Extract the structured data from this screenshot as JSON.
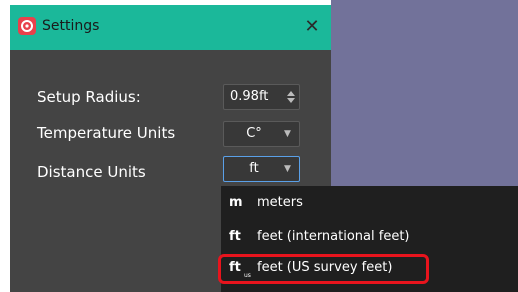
{
  "window": {
    "title": "Settings",
    "close_glyph": "✕",
    "app_icon": "app-logo-icon",
    "titlebar_color": "#1bb89a",
    "background_color": "#444444"
  },
  "viewport": {
    "color": "#72729a"
  },
  "settings": {
    "setup_radius": {
      "label": "Setup Radius:",
      "value": "0.98ft"
    },
    "temperature_units": {
      "label": "Temperature Units",
      "value": "C°"
    },
    "distance_units": {
      "label": "Distance Units",
      "value": "ft"
    }
  },
  "dropdown": {
    "options": [
      {
        "symbol": "m",
        "subscript": "",
        "label": "meters"
      },
      {
        "symbol": "ft",
        "subscript": "",
        "label": "feet (international feet)"
      },
      {
        "symbol": "ft",
        "subscript": "us",
        "label": "feet (US survey feet)"
      }
    ],
    "highlight_color": "#e8141d"
  }
}
